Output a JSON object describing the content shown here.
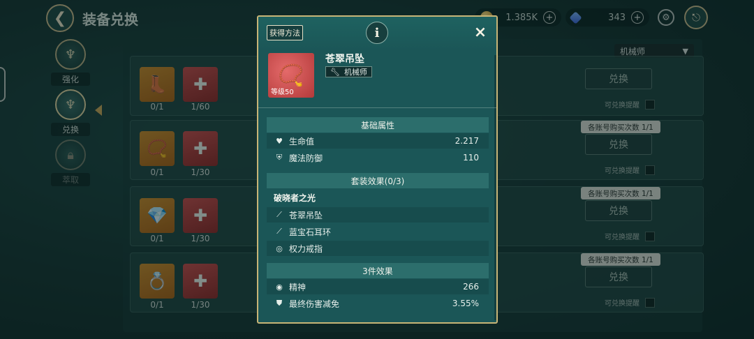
{
  "header": {
    "title": "装备兑换",
    "back_icon": "back-arrow-icon"
  },
  "currencies": [
    {
      "icon": "gold-coin-icon",
      "value": "1.385K",
      "plus": "+"
    },
    {
      "icon": "blue-gem-icon",
      "value": "343",
      "plus": "+"
    }
  ],
  "sidebar": {
    "items": [
      {
        "label": "强化",
        "icon": "trident-emblem-icon",
        "state": "normal"
      },
      {
        "label": "兑换",
        "icon": "trident-emblem-icon",
        "state": "active"
      },
      {
        "label": "萃取",
        "icon": "lock-icon",
        "state": "locked"
      }
    ]
  },
  "class_filter": {
    "selected": "机械师"
  },
  "list": {
    "rows": [
      {
        "item_count": "0/1",
        "material_count": "1/60",
        "exchange_label": "兑换",
        "remind_label": "可兑换提醒",
        "limit": ""
      },
      {
        "item_count": "0/1",
        "material_count": "1/30",
        "exchange_label": "兑换",
        "remind_label": "可兑换提醒",
        "limit": "各账号购买次数 1/1"
      },
      {
        "item_count": "0/1",
        "material_count": "1/30",
        "exchange_label": "兑换",
        "remind_label": "可兑换提醒",
        "limit": "各账号购买次数 1/1"
      },
      {
        "item_count": "0/1",
        "material_count": "1/30",
        "exchange_label": "兑换",
        "remind_label": "可兑换提醒",
        "limit": "各账号购买次数 1/1"
      }
    ]
  },
  "modal": {
    "source_button": "获得方法",
    "info_icon": "i",
    "close_icon": "×",
    "item": {
      "name": "苍翠吊坠",
      "level": "等级50",
      "class_label": "机械师"
    },
    "base_stats": {
      "header": "基础属性",
      "rows": [
        {
          "icon": "heart-icon",
          "label": "生命值",
          "value": "2.217"
        },
        {
          "icon": "shield-icon",
          "label": "魔法防御",
          "value": "110"
        }
      ]
    },
    "set": {
      "header": "套装效果(0/3)",
      "name": "破晓者之光",
      "pieces": [
        {
          "icon": "pendant-icon",
          "label": "苍翠吊坠"
        },
        {
          "icon": "earring-icon",
          "label": "蓝宝石耳环"
        },
        {
          "icon": "ring-icon",
          "label": "权力戒指"
        }
      ]
    },
    "effect3": {
      "header": "3件效果",
      "rows": [
        {
          "icon": "eye-icon",
          "label": "精神",
          "value": "266"
        },
        {
          "icon": "damage-reduction-icon",
          "label": "最终伤害减免",
          "value": "3.55%"
        }
      ]
    }
  }
}
